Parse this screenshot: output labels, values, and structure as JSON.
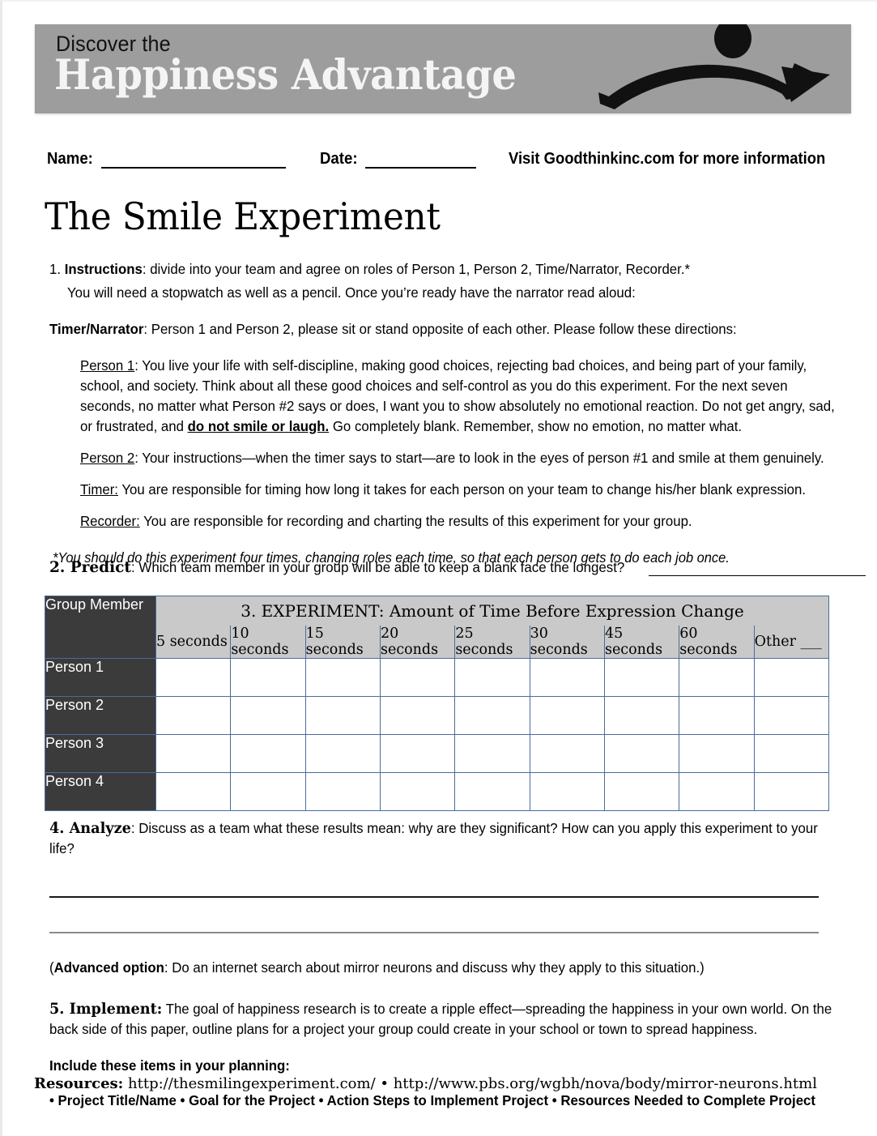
{
  "banner": {
    "line1": "Discover the",
    "line2": "Happiness Advantage",
    "logo_icon": "smile-arrow-icon",
    "bg_color": "#9d9d9d"
  },
  "id_row": {
    "name_label": "Name:",
    "date_label": "Date:",
    "visit_text": "Visit Goodthinkinc.com for more information"
  },
  "title": "The Smile Experiment",
  "instructions": {
    "item1_number": "1.",
    "item1_label": "Instructions",
    "item1_text": ": divide into your team and agree on roles of Person 1, Person 2, Time/Narrator, Recorder.*",
    "item1_line2": "You will need a stopwatch as well as a pencil. Once you’re ready have the narrator read aloud:",
    "narrator_label": "Timer/Narrator",
    "narrator_text": ": Person 1 and Person 2, please sit or stand opposite of each other. Please follow these directions:",
    "person1_label": "Person 1",
    "person1_text_a": ": You live your life with self-discipline, making good choices, rejecting bad choices, and being part of your family, school, and society. Think about all these good choices and self-control as you do this experiment. For the next seven seconds, no matter what Person #2 says or does, I want you to show absolutely no emotional reaction. Do not get angry, sad, or frustrated, and ",
    "person1_emphasis": "do not smile or laugh.",
    "person1_text_b": " Go completely blank. Remember, show no emotion, no matter what.",
    "person2_label": "Person 2",
    "person2_text": ": Your instructions—when the timer says to start—are to look in the eyes of person #1 and smile at them genuinely.",
    "timer_label": "Timer:",
    "timer_text": " You are responsible for timing how long it takes for each person on your team to change his/her blank expression.",
    "recorder_label": "Recorder:",
    "recorder_text": " You are responsible for recording and charting the results of this experiment for your group.",
    "footnote": "*You should do this experiment four times, changing roles each time, so that each person gets to do each job once."
  },
  "predict": {
    "number_label": "2. Predict",
    "text": ": Which team member in your group will be able to keep a blank face the longest?"
  },
  "table": {
    "corner_header": "Group Member",
    "span_header": "3. EXPERIMENT: Amount of Time Before Expression Change",
    "columns": [
      "5 seconds",
      "10 seconds",
      "15 seconds",
      "20 seconds",
      "25 seconds",
      "30 seconds",
      "45 seconds",
      "60 seconds",
      "Other ___"
    ],
    "rows": [
      "Person 1",
      "Person 2",
      "Person 3",
      "Person 4"
    ],
    "header_bg": "#c9c9c9",
    "label_bg": "#3b3b3b",
    "border_color": "#4a6c9b"
  },
  "analyze": {
    "number_label": "4. Analyze",
    "text": ":  Discuss as a team what these results mean: why are they significant? How can you apply this experiment to your life?"
  },
  "advanced": {
    "open_paren": "(",
    "label": "Advanced option",
    "text": ": Do an internet search about mirror neurons and discuss why they apply to this situation.)"
  },
  "implement": {
    "number_label": "5. Implement:",
    "text": " The goal of happiness research is to create a ripple effect—spreading the happiness in your own world. On the back side of this paper, outline plans for a project your group could create in your school or town to spread happiness.",
    "include_heading": "Include these items in your planning:",
    "bullets_line": "• Project Title/Name • Goal for the Project • Action Steps to Implement Project • Resources Needed to Complete Project"
  },
  "footer": {
    "label": "Resources:",
    "urls": " http://thesmilingexperiment.com/ • http://www.pbs.org/wgbh/nova/body/mirror-neurons.html"
  }
}
